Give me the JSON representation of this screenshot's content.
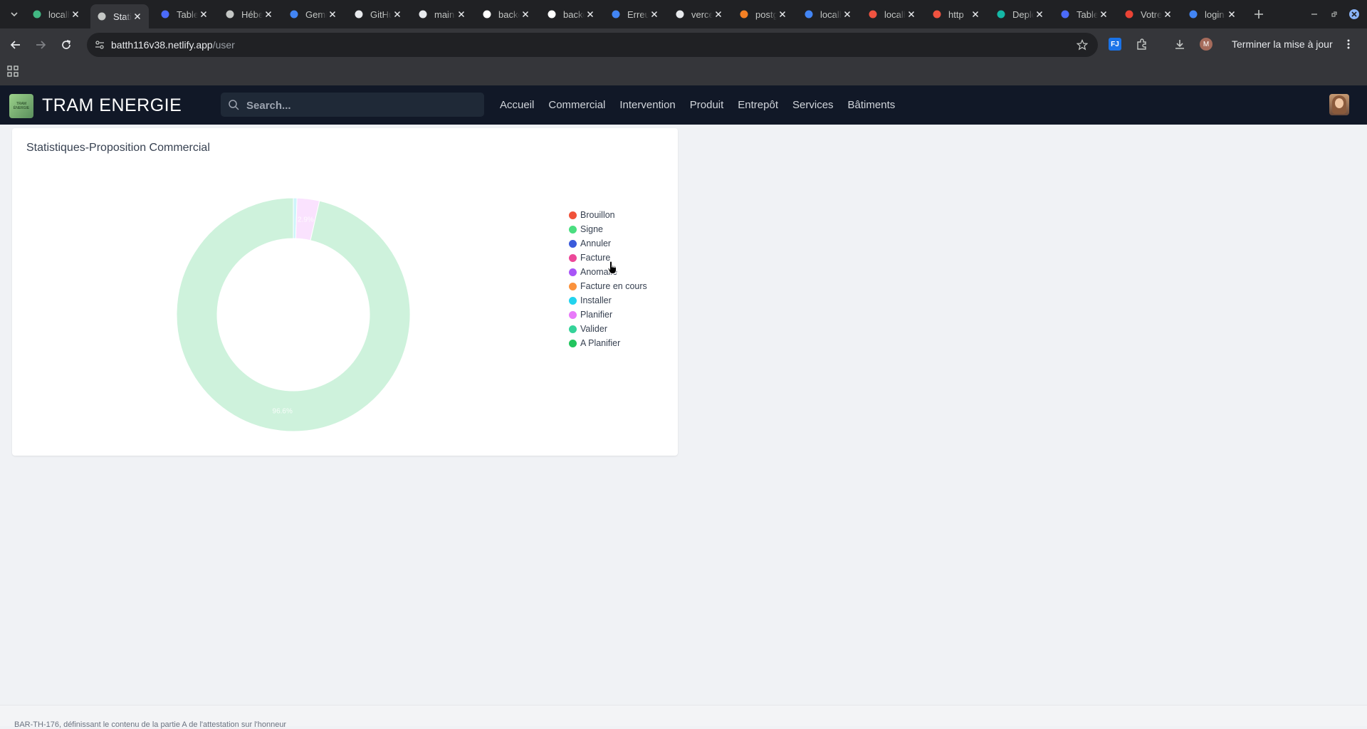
{
  "browser": {
    "tabs": [
      {
        "title": "localhost",
        "favicon": "nuxt-icon",
        "color": "#42b883"
      },
      {
        "title": "Statistiques",
        "favicon": "globe-icon",
        "color": "#c4c7c5",
        "active": true
      },
      {
        "title": "Tableau",
        "favicon": "trello-icon",
        "color": "#4b6bfb"
      },
      {
        "title": "Hébergement",
        "favicon": "openai-icon",
        "color": "#c4c7c5"
      },
      {
        "title": "Gemini",
        "favicon": "gemini-icon",
        "color": "#4285f4"
      },
      {
        "title": "GitHub",
        "favicon": "github-icon",
        "color": "#e8eaed"
      },
      {
        "title": "main",
        "favicon": "github-icon",
        "color": "#e8eaed"
      },
      {
        "title": "backend",
        "favicon": "vercel-icon",
        "color": "#ffffff"
      },
      {
        "title": "backend",
        "favicon": "vercel-icon",
        "color": "#ffffff"
      },
      {
        "title": "Erreur",
        "favicon": "google-icon",
        "color": "#4285f4"
      },
      {
        "title": "vercel",
        "favicon": "github-icon",
        "color": "#e8eaed"
      },
      {
        "title": "postgres",
        "favicon": "stackoverflow-icon",
        "color": "#f48024"
      },
      {
        "title": "localhost",
        "favicon": "google-icon",
        "color": "#4285f4"
      },
      {
        "title": "localhost",
        "favicon": "laravel-icon",
        "color": "#f05340"
      },
      {
        "title": "http",
        "favicon": "laravel-icon",
        "color": "#f05340"
      },
      {
        "title": "Deploy",
        "favicon": "diamond-icon",
        "color": "#14b8a6"
      },
      {
        "title": "Tableau",
        "favicon": "trello-icon",
        "color": "#4b6bfb"
      },
      {
        "title": "Votre",
        "favicon": "gmail-icon",
        "color": "#ea4335"
      },
      {
        "title": "login",
        "favicon": "google-icon",
        "color": "#4285f4"
      }
    ],
    "url_host": "batth116v38.netlify.app",
    "url_path": "/user",
    "profile_initial": "M",
    "update_label": "Terminer la mise à jour"
  },
  "app": {
    "brand": "TRAM ENERGIE",
    "logo_text": "TRAM ÉNERGIE",
    "search_placeholder": "Search...",
    "nav": [
      "Accueil",
      "Commercial",
      "Intervention",
      "Produit",
      "Entrepôt",
      "Services",
      "Bâtiments"
    ]
  },
  "card": {
    "title": "Statistiques-Proposition Commercial"
  },
  "chart_data": {
    "type": "pie",
    "donut": true,
    "legend_position": "right",
    "categories": [
      "Brouillon",
      "Signe",
      "Annuler",
      "Facture",
      "Anomalie",
      "Facture en cours",
      "Installer",
      "Planifier",
      "Valider",
      "A Planifier"
    ],
    "colors": [
      "#f0523a",
      "#4ade80",
      "#3b5bdb",
      "#ec4899",
      "#a855f7",
      "#fb923c",
      "#22d3ee",
      "#e879f9",
      "#34d399",
      "#22c55e"
    ],
    "values": [
      0,
      0,
      0,
      0,
      0,
      0,
      0.5,
      3.1,
      0,
      96.4
    ],
    "slice_labels": [
      "",
      "",
      "",
      "",
      "",
      "",
      "",
      "2.9%",
      "",
      "96.6%"
    ]
  },
  "footer": {
    "text": "BAR-TH-176, définissant le contenu de la partie A de l'attestation sur l'honneur"
  }
}
